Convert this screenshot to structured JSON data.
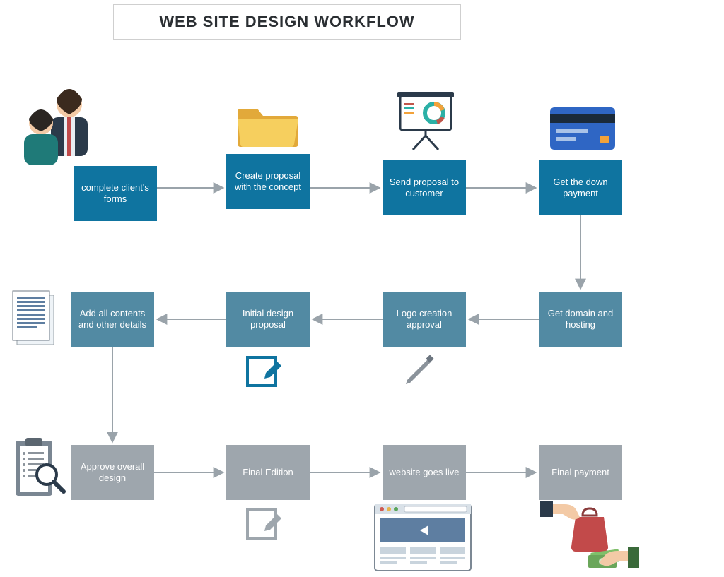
{
  "title": "WEB SITE DESIGN WORKFLOW",
  "nodes": {
    "n1": "complete client's forms",
    "n2": "Create proposal with the concept",
    "n3": "Send proposal to customer",
    "n4": "Get the down payment",
    "n5": "Get domain and hosting",
    "n6": "Logo creation approval",
    "n7": "Initial design proposal",
    "n8": "Add all contents and other details",
    "n9": "Approve overall design",
    "n10": "Final Edition",
    "n11": "website goes live",
    "n12": "Final payment"
  },
  "flow_edges": [
    [
      "n1",
      "n2"
    ],
    [
      "n2",
      "n3"
    ],
    [
      "n3",
      "n4"
    ],
    [
      "n4",
      "n5"
    ],
    [
      "n5",
      "n6"
    ],
    [
      "n6",
      "n7"
    ],
    [
      "n7",
      "n8"
    ],
    [
      "n8",
      "n9"
    ],
    [
      "n9",
      "n10"
    ],
    [
      "n10",
      "n11"
    ],
    [
      "n11",
      "n12"
    ]
  ]
}
